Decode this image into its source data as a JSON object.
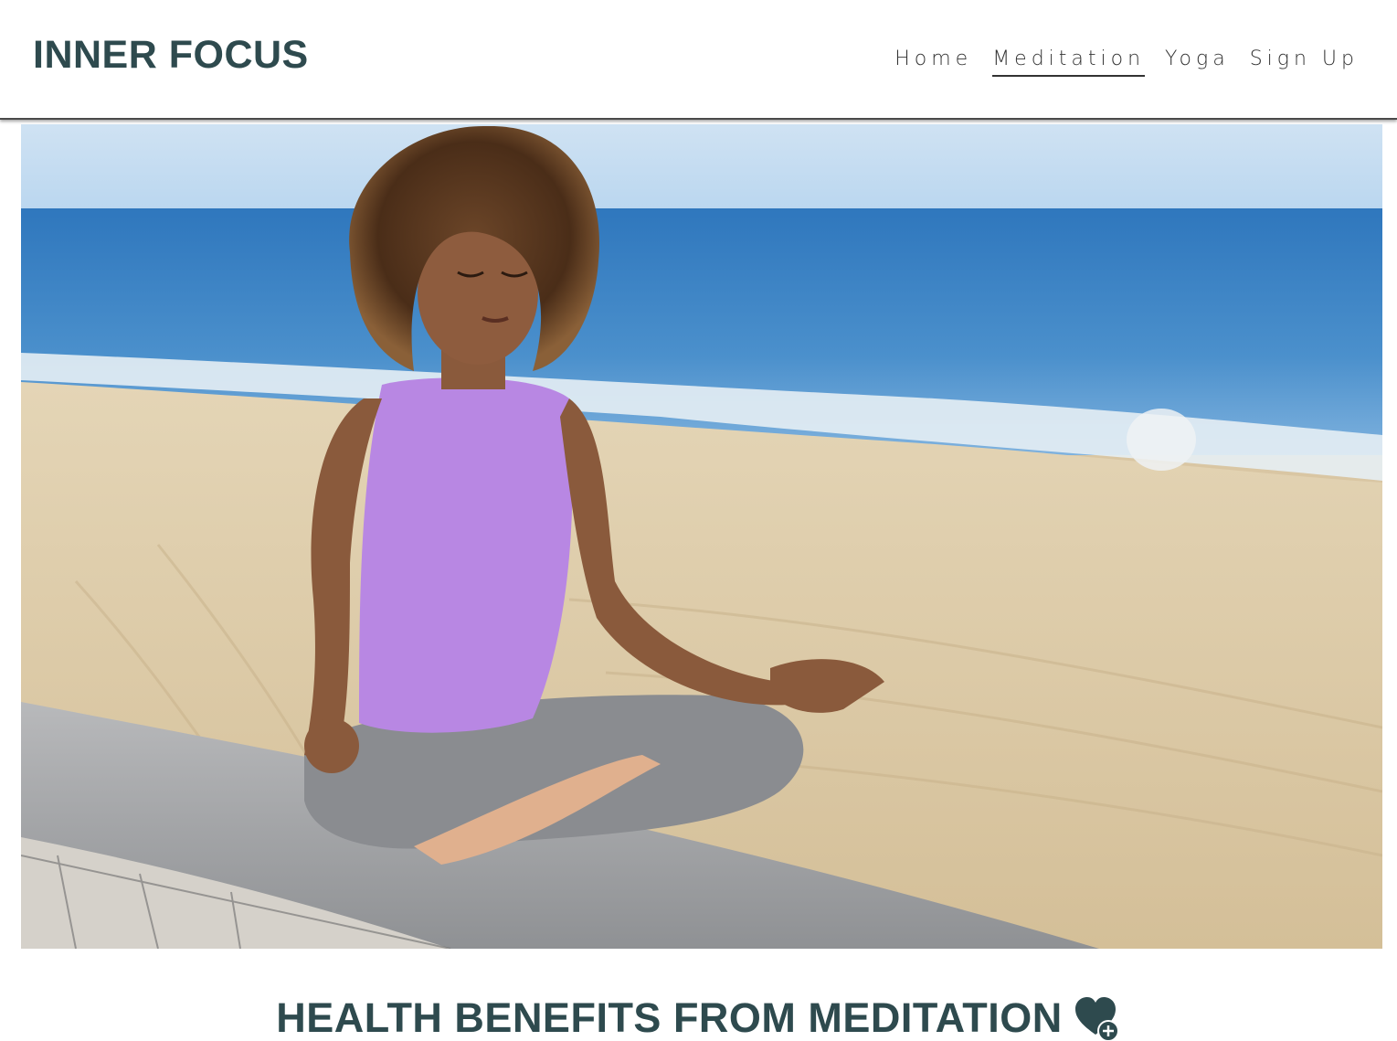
{
  "header": {
    "logo": "INNER FOCUS",
    "nav": [
      {
        "label": "Home",
        "active": false
      },
      {
        "label": "Meditation",
        "active": true
      },
      {
        "label": "Yoga",
        "active": false
      },
      {
        "label": "Sign Up",
        "active": false
      }
    ]
  },
  "hero": {
    "image_icon": "meditation-photo"
  },
  "section": {
    "title": "HEALTH BENEFITS FROM MEDITATION",
    "title_icon": "heart-plus-icon"
  },
  "colors": {
    "brand": "#2e4a4e",
    "nav_text": "#333333",
    "sea": "#3f86c4",
    "sand": "#d9c6a3",
    "tank_top": "#b887e3"
  }
}
